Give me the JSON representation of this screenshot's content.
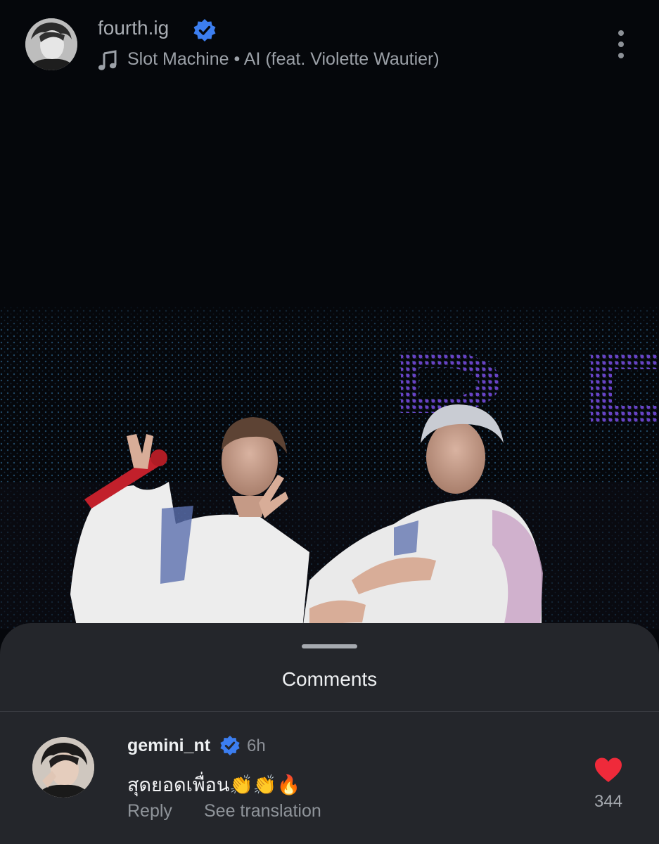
{
  "header": {
    "username": "fourth.ig",
    "song": "Slot Machine • AI (feat. Violette Wautier)"
  },
  "comments_sheet": {
    "title": "Comments",
    "comment": {
      "username": "gemini_nt",
      "time": "6h",
      "text": "สุดยอดเพื่อน👏👏🔥",
      "reply_label": "Reply",
      "translate_label": "See translation",
      "likes": "344"
    }
  },
  "colors": {
    "background": "#05070b",
    "sheet": "#24262b",
    "verified": "#3c7ef0",
    "heart": "#ef2a3a",
    "muted_text": "#8f949a"
  },
  "icons": [
    "music-note-icon",
    "verified-badge-icon",
    "more-vertical-icon",
    "heart-icon"
  ]
}
